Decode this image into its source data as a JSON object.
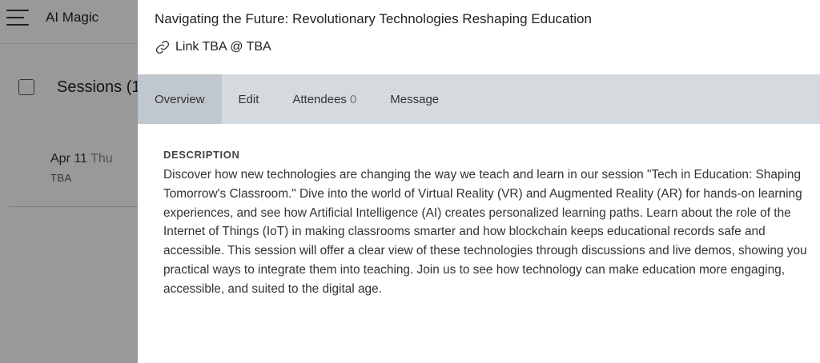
{
  "app": {
    "title": "AI Magic",
    "menu_icon": "hamburger-menu-icon"
  },
  "sessions": {
    "title": "Sessions (1",
    "items": [
      {
        "date": "Apr 11",
        "day": "Thu",
        "location": "TBA"
      }
    ]
  },
  "drawer": {
    "title": "Navigating the Future: Revolutionary Technologies Reshaping Education",
    "link_icon": "link-icon",
    "link_text": "Link TBA @ TBA",
    "tabs": [
      {
        "label": "Overview",
        "active": true
      },
      {
        "label": "Edit"
      },
      {
        "label": "Attendees",
        "count": "0"
      },
      {
        "label": "Message"
      }
    ],
    "description": {
      "heading": "DESCRIPTION",
      "body": "Discover how new technologies are changing the way we teach and learn in our session \"Tech in Education: Shaping Tomorrow's Classroom.\" Dive into the world of Virtual Reality (VR) and Augmented Reality (AR) for hands-on learning experiences, and see how Artificial Intelligence (AI) creates personalized learning paths. Learn about the role of the Internet of Things (IoT) in making classrooms smarter and how blockchain keeps educational records safe and accessible. This session will offer a clear view of these technologies through discussions and live demos, showing you practical ways to integrate them into teaching. Join us to see how technology can make education more engaging, accessible, and suited to the digital age."
    }
  },
  "colors": {
    "overlay": "#666666",
    "tab_bar": "#d5dadf",
    "tab_active": "#c0c7ce"
  }
}
